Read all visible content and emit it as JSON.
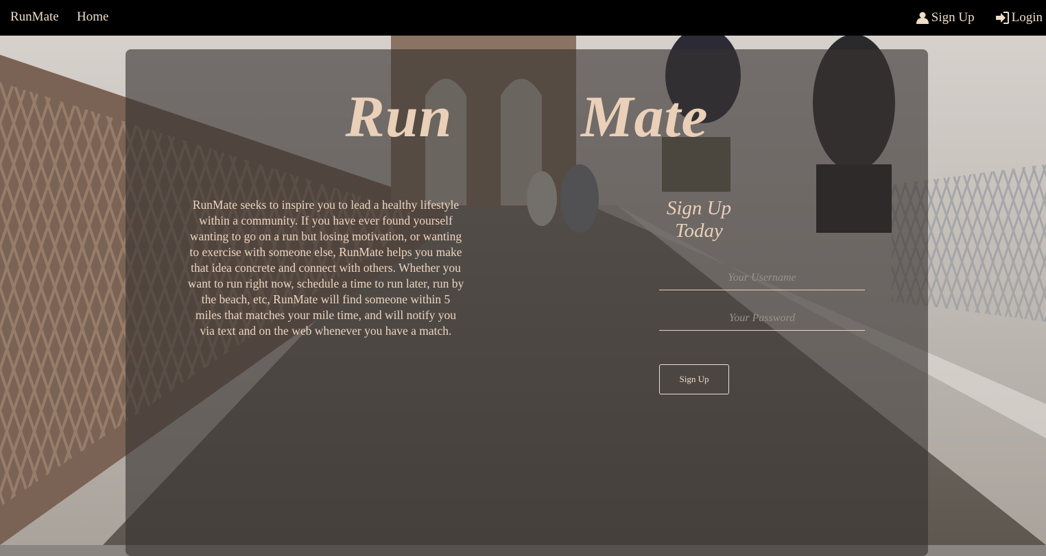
{
  "navbar": {
    "brand": "RunMate",
    "home": "Home",
    "signup": {
      "label": "Sign Up",
      "icon": "user-icon"
    },
    "login": {
      "label": "Login",
      "icon": "login-icon"
    }
  },
  "hero": {
    "title": "Run   Mate"
  },
  "about": {
    "text": "RunMate seeks to inspire you to lead a healthy lifestyle within a community. If you have ever found yourself wanting to go on a run but losing motivation, or wanting to exercise with someone else, RunMate helps you make that idea concrete and connect with others. Whether you want to run right now, schedule a time to run later, run by the beach, etc, RunMate will find someone within 5 miles that matches your mile time, and will notify you via text and on the web whenever you have a match."
  },
  "signup_form": {
    "heading": "Sign Up Today",
    "username_placeholder": "Your Username",
    "password_placeholder": "Your Password",
    "submit_label": "Sign Up"
  },
  "colors": {
    "navbar_bg": "#000000",
    "text_accent": "#ead0b8",
    "panel_overlay": "rgba(55,50,48,0.62)"
  }
}
